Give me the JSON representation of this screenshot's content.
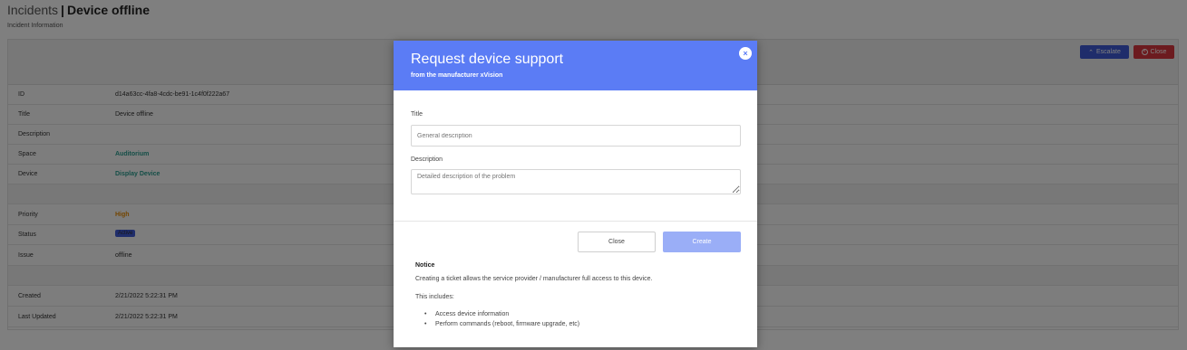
{
  "page": {
    "breadcrumb": "Incidents",
    "separator": "|",
    "title": "Device offline",
    "subtitle": "Incident Information",
    "escalate_label": "Escalate",
    "close_label": "Close"
  },
  "details": [
    {
      "label": "ID",
      "value": "d14a63cc-4fa8-4cdc-be91-1c4f0f222a67"
    },
    {
      "label": "Title",
      "value": "Device offline"
    },
    {
      "label": "Description",
      "value": ""
    },
    {
      "label": "Space",
      "value": "Auditorium"
    },
    {
      "label": "Device",
      "value": "Display Device"
    },
    {
      "label": "Priority",
      "value": "High"
    },
    {
      "label": "Status",
      "value": "Active"
    },
    {
      "label": "Issue",
      "value": "offline"
    },
    {
      "label": "Created",
      "value": "2/21/2022 5:22:31 PM"
    },
    {
      "label": "Last Updated",
      "value": "2/21/2022 5:22:31 PM"
    }
  ],
  "modal": {
    "title": "Request device support",
    "subtitle": "from the manufacturer xVision",
    "close_icon": "×",
    "title_label": "Title",
    "title_placeholder": "General description",
    "description_label": "Description",
    "description_placeholder": "Detailed description of the problem",
    "close_button": "Close",
    "create_button": "Create",
    "notice_heading": "Notice",
    "notice_text": "Creating a ticket allows the service provider / manufacturer full access to this device.",
    "includes_text": "This includes:",
    "includes": [
      "Access device information",
      "Perform commands (reboot, firmware upgrade, etc)"
    ]
  },
  "colors": {
    "modal_header": "#5b7cf5",
    "escalate": "#3f5bd6",
    "close": "#d9363e",
    "create_disabled": "#9aaef7",
    "link": "#2a9d8f",
    "priority_high": "#e68a00"
  }
}
